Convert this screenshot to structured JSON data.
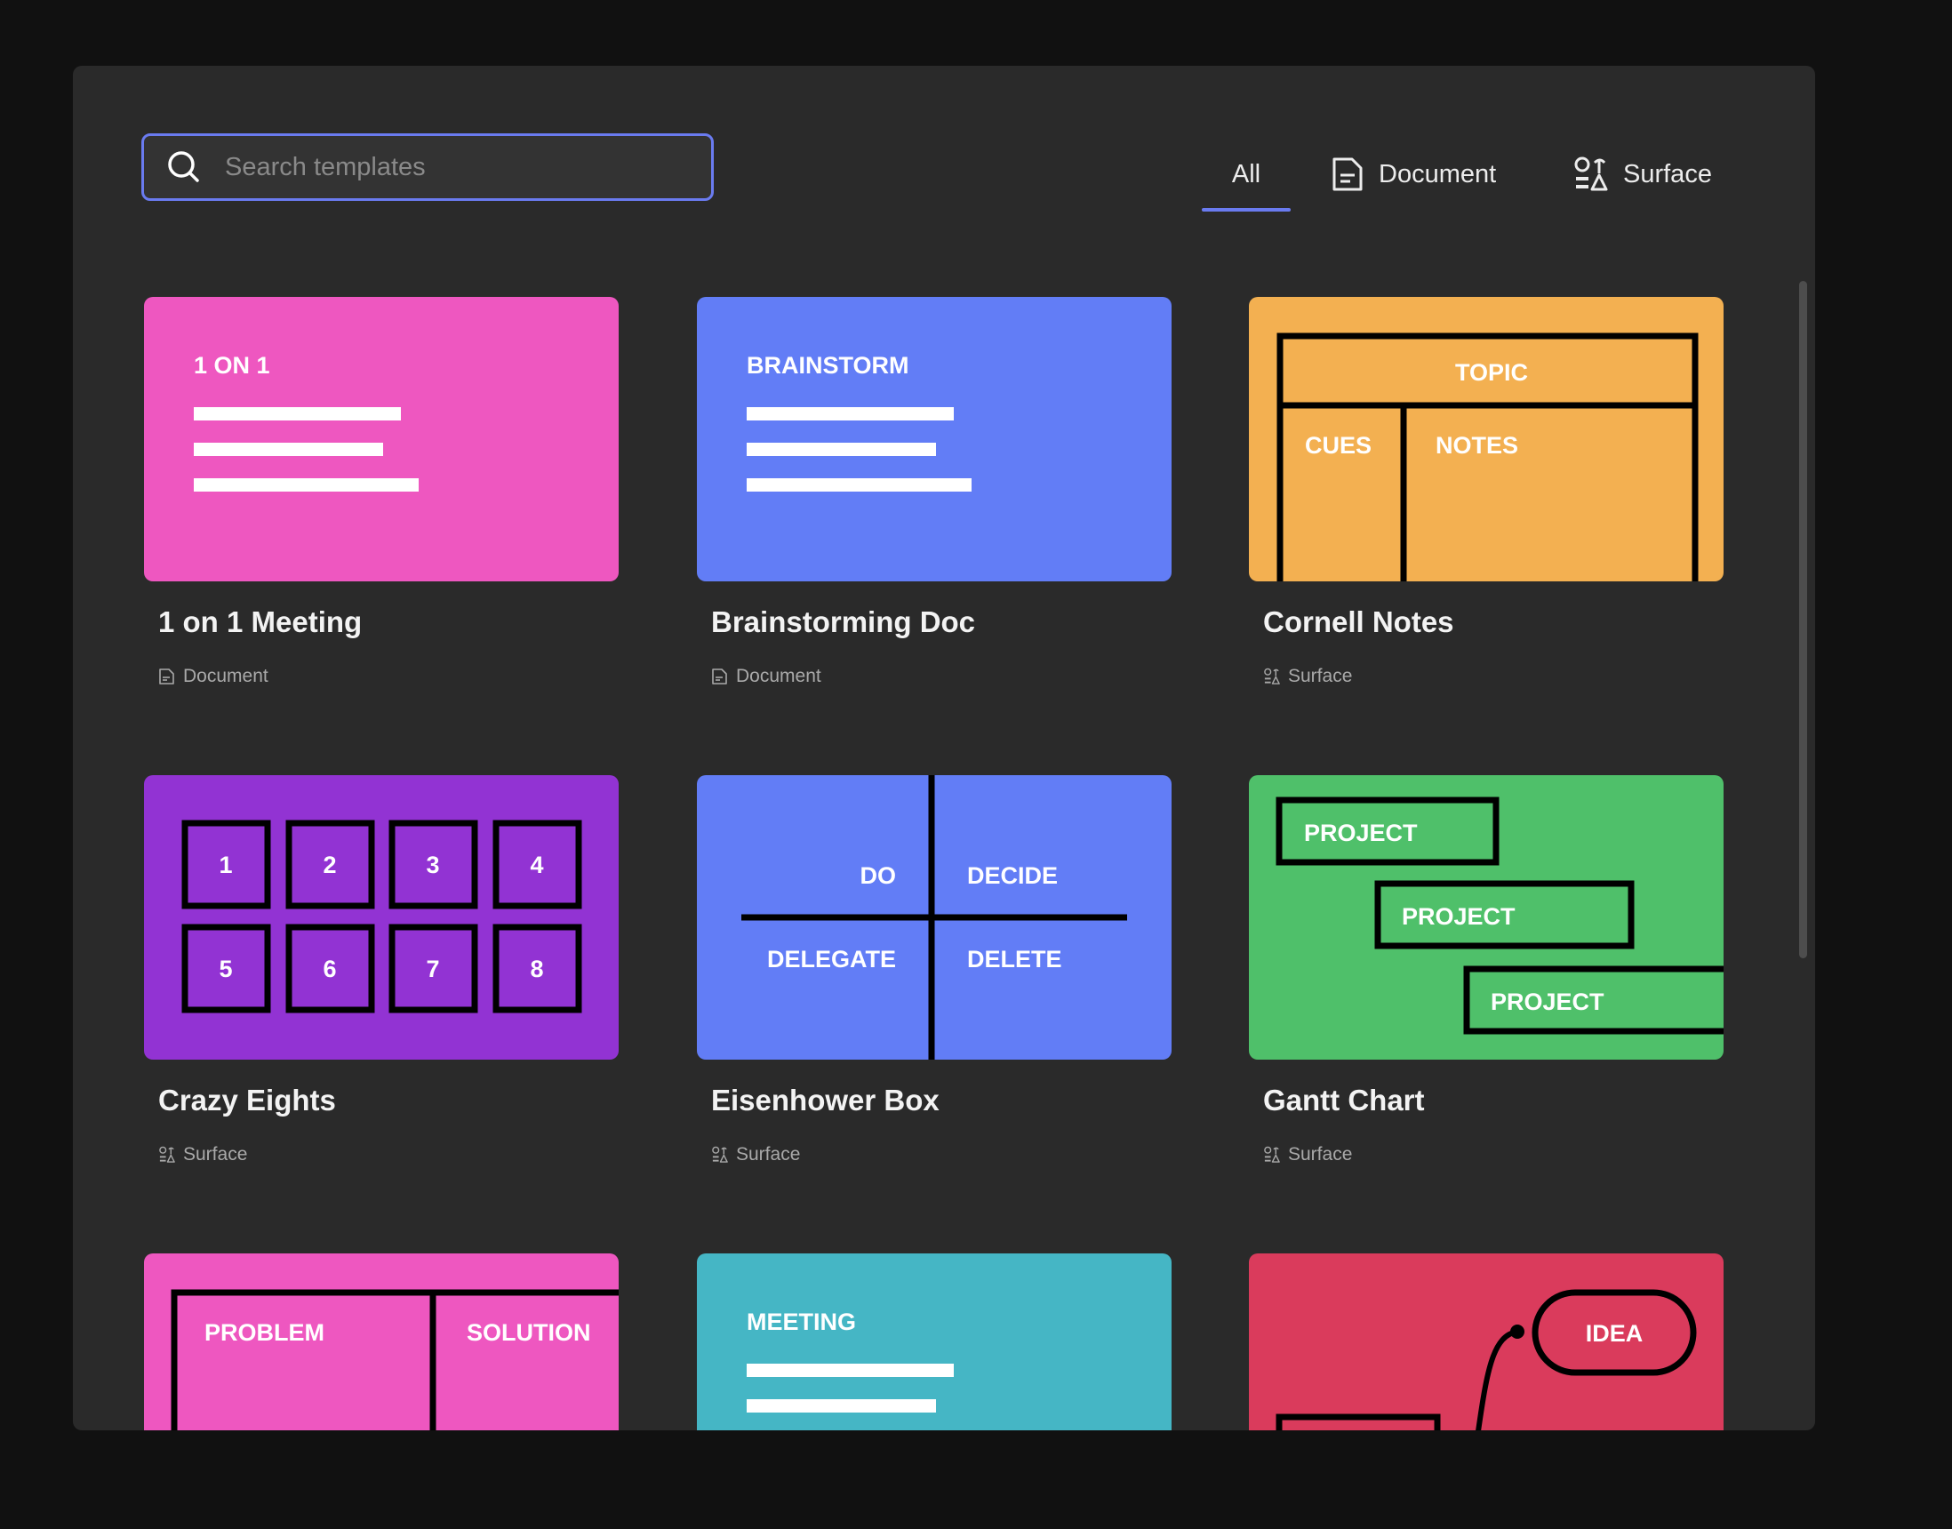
{
  "search": {
    "placeholder": "Search templates"
  },
  "tabs": {
    "all": "All",
    "document": "Document",
    "surface": "Surface"
  },
  "cards": [
    {
      "title": "1 on 1 Meeting",
      "type": "Document",
      "color": "#ee57c0",
      "thumb": {
        "heading": "1 ON 1"
      }
    },
    {
      "title": "Brainstorming Doc",
      "type": "Document",
      "color": "#627df6",
      "thumb": {
        "heading": "BRAINSTORM"
      }
    },
    {
      "title": "Cornell Notes",
      "type": "Surface",
      "color": "#f3b051",
      "thumb": {
        "topic": "TOPIC",
        "cues": "CUES",
        "notes": "NOTES"
      }
    },
    {
      "title": "Crazy Eights",
      "type": "Surface",
      "color": "#9233d3",
      "thumb": {
        "numbers": [
          "1",
          "2",
          "3",
          "4",
          "5",
          "6",
          "7",
          "8"
        ]
      }
    },
    {
      "title": "Eisenhower Box",
      "type": "Surface",
      "color": "#627df6",
      "thumb": {
        "do": "DO",
        "decide": "DECIDE",
        "delegate": "DELEGATE",
        "delete": "DELETE"
      }
    },
    {
      "title": "Gantt Chart",
      "type": "Surface",
      "color": "#4fc06a",
      "thumb": {
        "project": "PROJECT"
      }
    },
    {
      "color": "#ee57c0",
      "thumb": {
        "problem": "PROBLEM",
        "solution": "SOLUTION"
      }
    },
    {
      "color": "#45b6c5",
      "thumb": {
        "heading": "MEETING"
      }
    },
    {
      "color": "#da3b5c",
      "thumb": {
        "idea": "IDEA"
      }
    }
  ]
}
